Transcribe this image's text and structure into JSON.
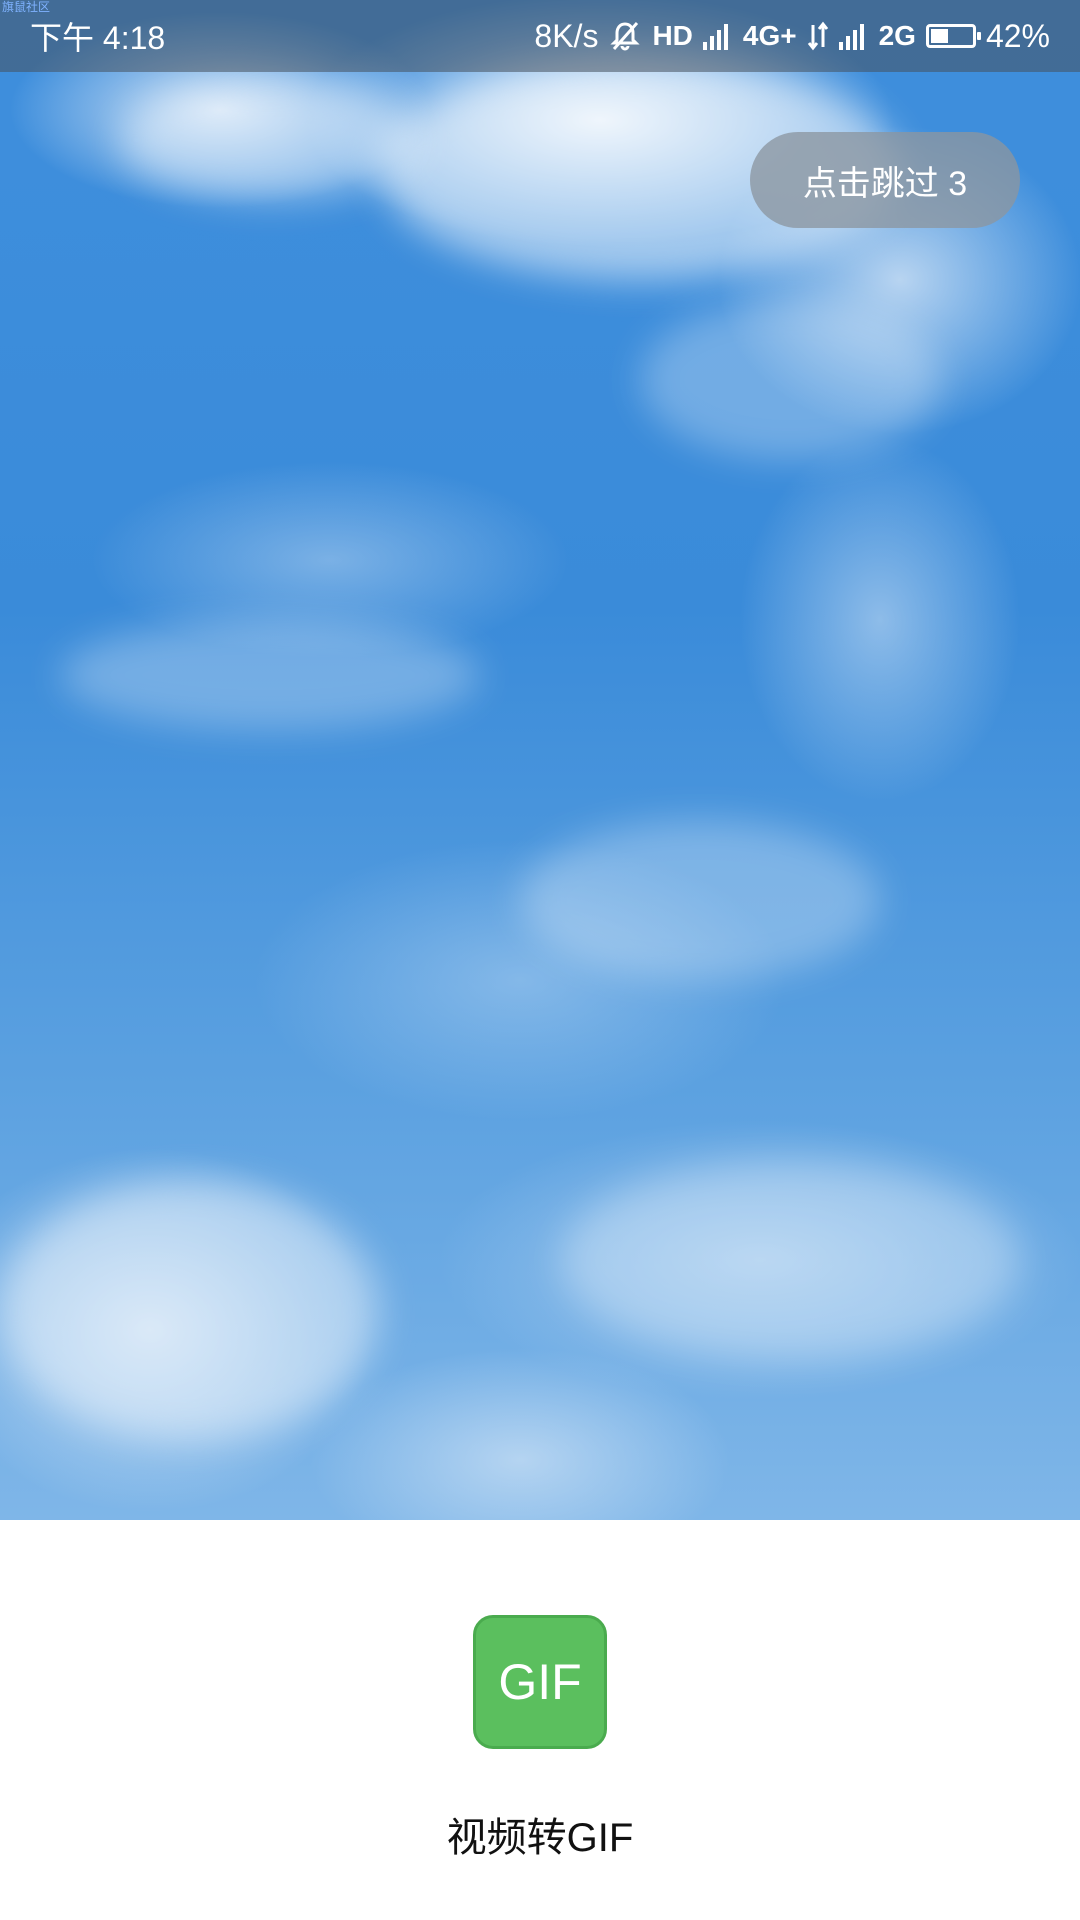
{
  "status_bar": {
    "tiny_tag": "旗鼠社区",
    "time": "下午 4:18",
    "net_speed": "8K/s",
    "hd": "HD",
    "net1": "4G+",
    "net2": "2G",
    "battery_percent": "42%",
    "battery_level": 0.42,
    "icons": [
      "mute-bell-icon",
      "signal-icon",
      "data-arrows-icon",
      "battery-icon"
    ]
  },
  "splash": {
    "skip_label": "点击跳过 3"
  },
  "brand": {
    "logo_text": "GIF",
    "app_name": "视频转GIF",
    "logo_color": "#5bbf5e"
  }
}
